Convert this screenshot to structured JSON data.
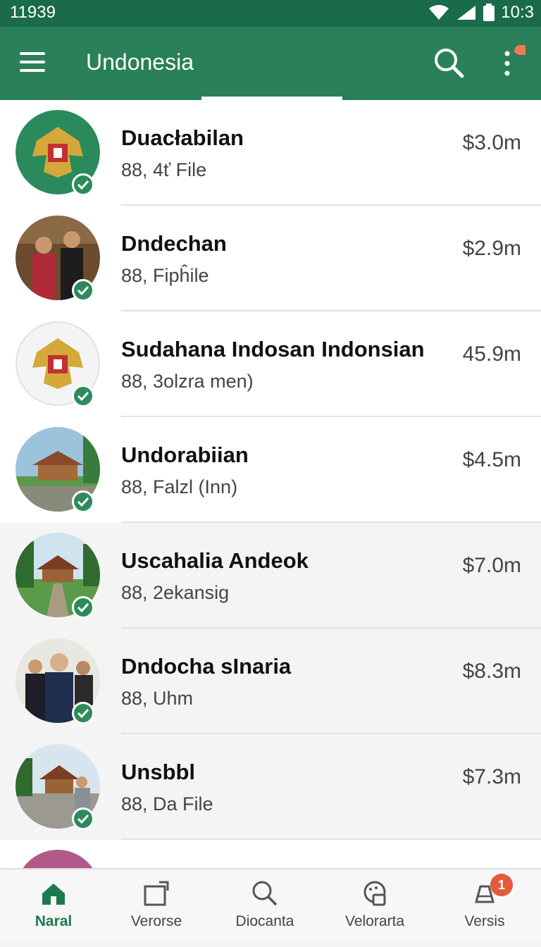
{
  "status_bar": {
    "left_text": "11939",
    "time": "10:3"
  },
  "app_bar": {
    "title": "Undonesia"
  },
  "rows": [
    {
      "name": "Duacłabilan",
      "sub": "88, 4ť File",
      "amount": "$3.0m"
    },
    {
      "name": "Dndechan",
      "sub": "88, Fipĥile",
      "amount": "$2.9m"
    },
    {
      "name": "Sudahana Indosan Indonsian",
      "sub": "88, 3olzra men)",
      "amount": "45.9m"
    },
    {
      "name": "Undorabiian",
      "sub": "88, Falzl (Inn)",
      "amount": "$4.5m"
    },
    {
      "name": "Uscahalia Andeok",
      "sub": "88, 2ekansig",
      "amount": "$7.0m"
    },
    {
      "name": "Dndocha sInaria",
      "sub": "88, Uhm",
      "amount": "$8.3m"
    },
    {
      "name": "Unsbbl",
      "sub": "88, Da File",
      "amount": "$7.3m"
    }
  ],
  "bottom_nav": [
    {
      "label": "Naral",
      "active": true
    },
    {
      "label": "Verorse"
    },
    {
      "label": "Diocanta"
    },
    {
      "label": "Velorarta"
    },
    {
      "label": "Versis",
      "badge": "1"
    }
  ],
  "colors": {
    "primary": "#2a8058",
    "status_bar": "#1a6b4a",
    "accent": "#e55a3a",
    "check": "#2e8a5c"
  }
}
